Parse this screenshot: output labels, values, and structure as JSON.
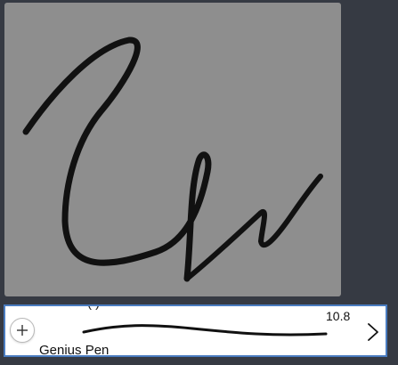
{
  "canvas": {
    "background": "#8e8e8e",
    "stroke_color": "#111111"
  },
  "brush": {
    "peek_label": "(            )",
    "name": "Genius Pen",
    "size": "10.8",
    "add_icon": "plus-icon",
    "next_icon": "chevron-right-icon",
    "accent": "#4a7cc0"
  },
  "app": {
    "background": "#363a43"
  }
}
